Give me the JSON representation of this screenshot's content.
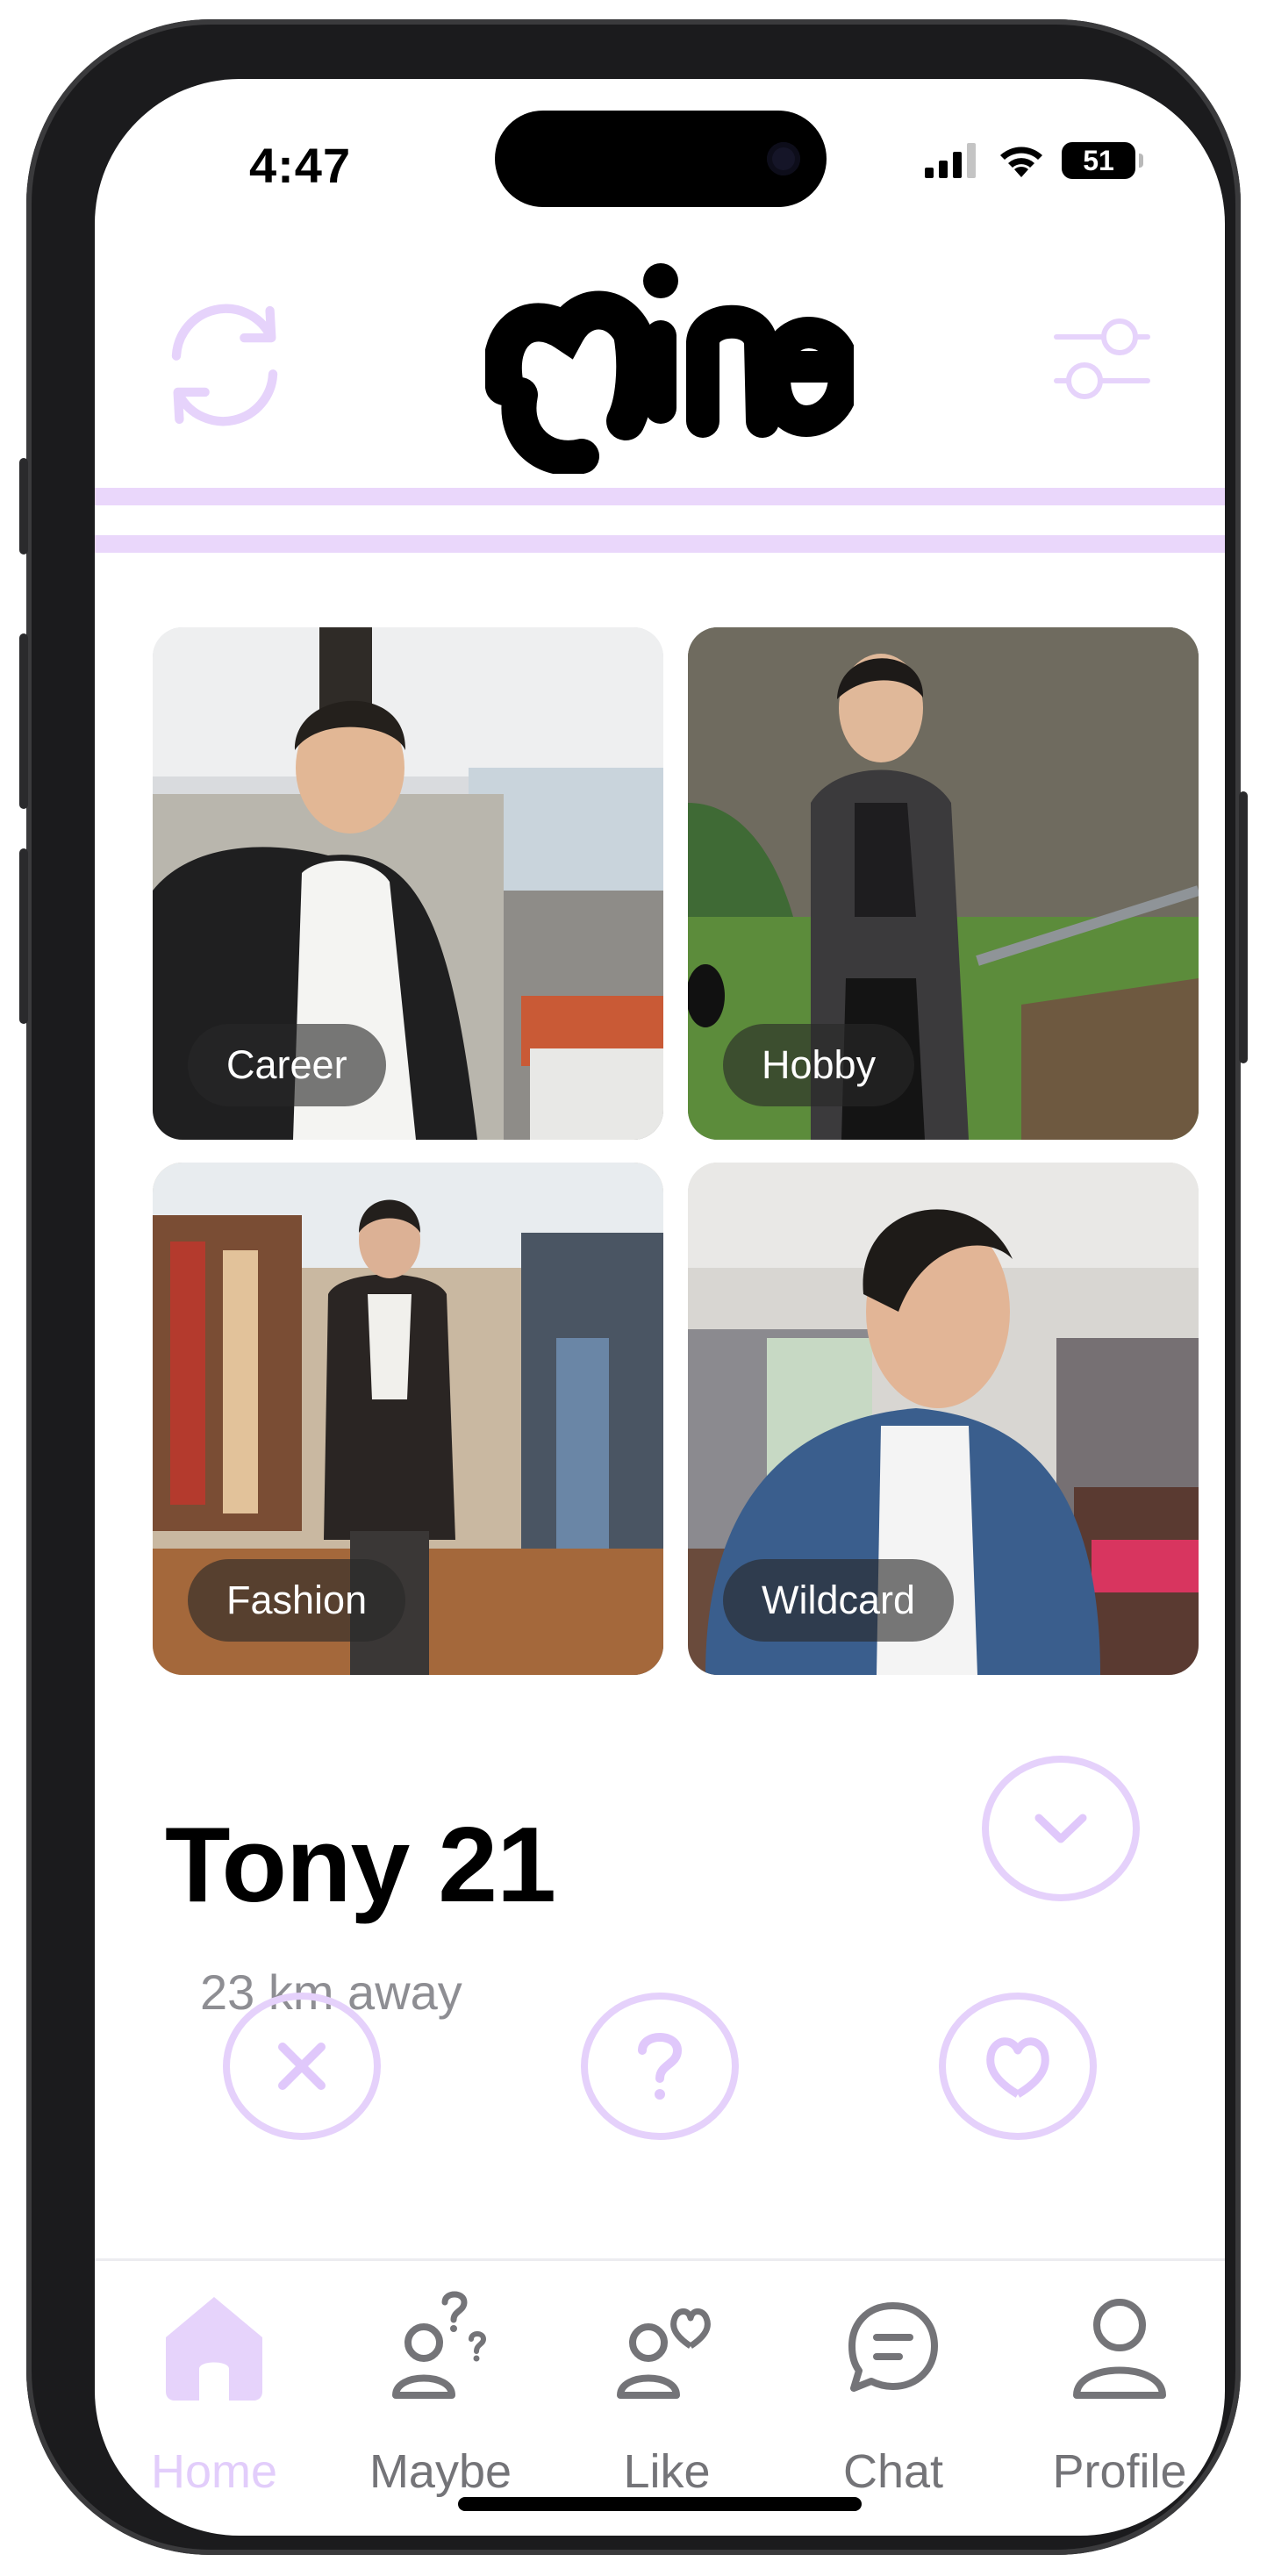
{
  "status_bar": {
    "time": "4:47",
    "battery": "51"
  },
  "header": {
    "logo_text": "mine",
    "refresh_icon": "refresh-icon",
    "filter_icon": "sliders-icon"
  },
  "photos": [
    {
      "label": "Career"
    },
    {
      "label": "Hobby"
    },
    {
      "label": "Fashion"
    },
    {
      "label": "Wildcard"
    }
  ],
  "profile": {
    "name_age": "Tony 21",
    "distance": "23 km away"
  },
  "actions": [
    "close-icon",
    "question-icon",
    "heart-icon"
  ],
  "nav": {
    "items": [
      {
        "label": "Home",
        "icon": "home-icon",
        "active": true
      },
      {
        "label": "Maybe",
        "icon": "maybe-person-icon",
        "active": false
      },
      {
        "label": "Like",
        "icon": "like-person-icon",
        "active": false
      },
      {
        "label": "Chat",
        "icon": "chat-icon",
        "active": false
      },
      {
        "label": "Profile",
        "icon": "profile-icon",
        "active": false
      }
    ]
  },
  "colors": {
    "accent": "#e5d1fb",
    "accent_soft": "#ead7fb",
    "nav_inactive": "#747478",
    "nav_active": "#e2cdfb"
  }
}
